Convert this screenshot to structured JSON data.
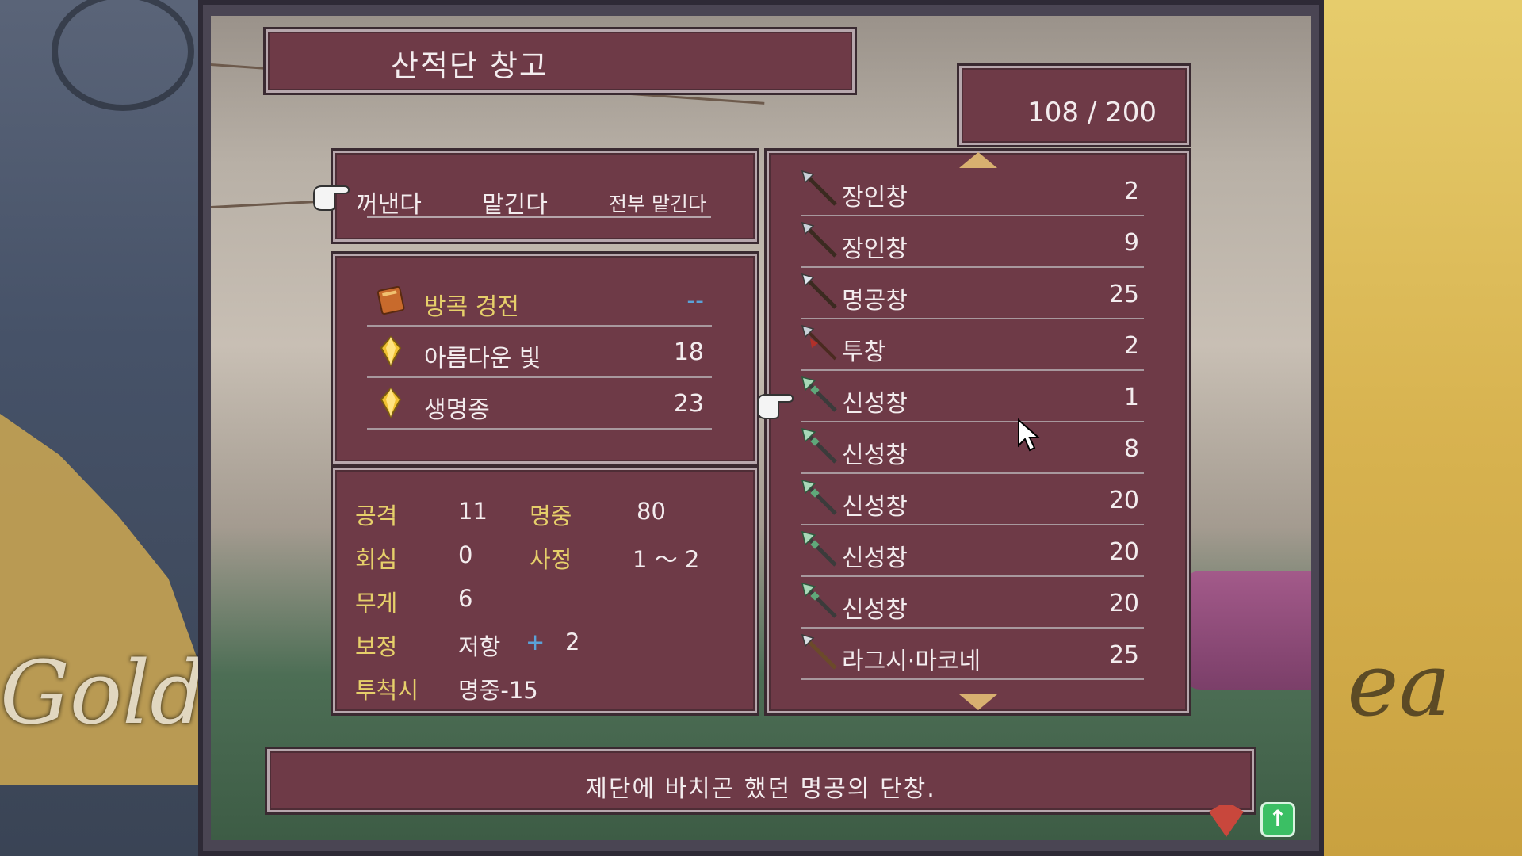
{
  "background": {
    "left_script": "Gold",
    "right_script": "ea"
  },
  "window": {
    "title": "산적단 창고",
    "capacity": "108 / 200"
  },
  "commands": [
    {
      "label": "꺼낸다"
    },
    {
      "label": "맡긴다"
    },
    {
      "label": "전부 맡긴다"
    }
  ],
  "special_items": [
    {
      "name": "방콕 경전",
      "value": "--",
      "icon": "book-icon"
    },
    {
      "name": "아름다운 빛",
      "value": "18",
      "icon": "gem-icon"
    },
    {
      "name": "생명종",
      "value": "23",
      "icon": "gem-icon"
    }
  ],
  "stats": {
    "attack_label": "공격",
    "attack": "11",
    "hit_label": "명중",
    "hit": "80",
    "crit_label": "회심",
    "crit": "0",
    "range_label": "사정",
    "range": "1 ～ 2",
    "weight_label": "무게",
    "weight": "6",
    "bonus_label": "보정",
    "bonus_stat": "저항",
    "bonus_plus": "+",
    "bonus_value": "2",
    "throw_label": "투척시",
    "throw_value": "명중-15"
  },
  "items": [
    {
      "name": "장인창",
      "count": "2",
      "icon": "spear-icon"
    },
    {
      "name": "장인창",
      "count": "9",
      "icon": "spear-icon"
    },
    {
      "name": "명공창",
      "count": "25",
      "icon": "spear-icon"
    },
    {
      "name": "투창",
      "count": "2",
      "icon": "javelin-icon"
    },
    {
      "name": "신성창",
      "count": "1",
      "icon": "holy-spear-icon"
    },
    {
      "name": "신성창",
      "count": "8",
      "icon": "holy-spear-icon"
    },
    {
      "name": "신성창",
      "count": "20",
      "icon": "holy-spear-icon"
    },
    {
      "name": "신성창",
      "count": "20",
      "icon": "holy-spear-icon"
    },
    {
      "name": "신성창",
      "count": "20",
      "icon": "holy-spear-icon"
    },
    {
      "name": "라그시·마코네",
      "count": "25",
      "icon": "spear-icon"
    }
  ],
  "description": "제단에 바치곤 했던 명공의 단창.",
  "colors": {
    "panel": "#6e3a47",
    "label_gold": "#e6cf6a",
    "accent_blue": "#5aa2d8"
  }
}
